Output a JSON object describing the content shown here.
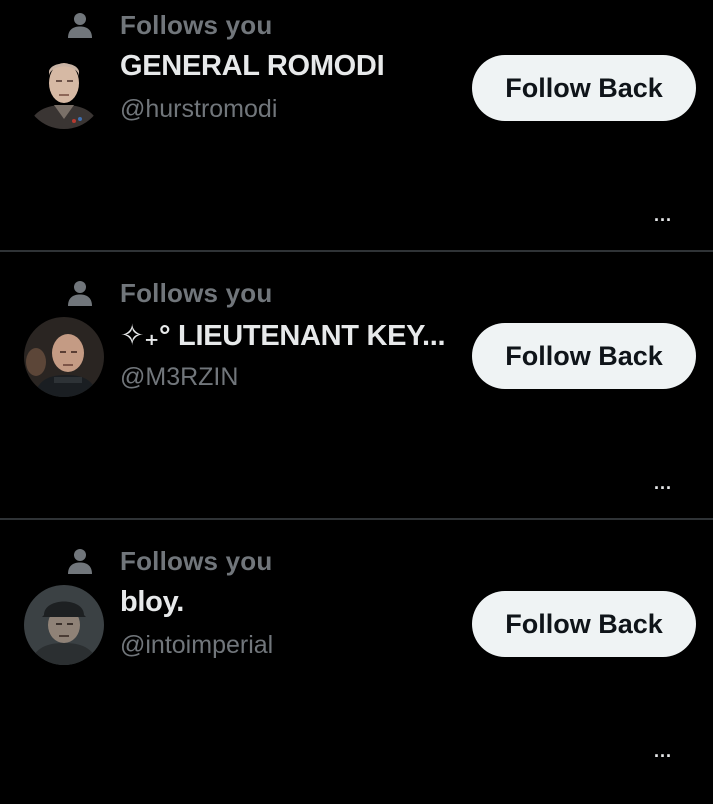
{
  "follow_list": [
    {
      "follows_you_label": "Follows you",
      "display_name": "GENERAL ROMODI",
      "handle": "@hurstromodi",
      "follow_back_label": "Follow Back",
      "more_label": "...",
      "avatar_icon": "avatar-general-romodi"
    },
    {
      "follows_you_label": "Follows you",
      "display_name": "✧₊° LIEUTENANT KEY...",
      "handle": "@M3RZIN",
      "follow_back_label": "Follow Back",
      "more_label": "...",
      "avatar_icon": "avatar-lieutenant-key"
    },
    {
      "follows_you_label": "Follows you",
      "display_name": "bloy.",
      "handle": "@intoimperial",
      "follow_back_label": "Follow Back",
      "more_label": "...",
      "avatar_icon": "avatar-bloy"
    }
  ],
  "colors": {
    "background": "#000000",
    "primary_text": "#e7e9ea",
    "secondary_text": "#71767b",
    "button_bg": "#eff3f4",
    "button_text": "#0f1419",
    "divider": "#2f3336"
  }
}
